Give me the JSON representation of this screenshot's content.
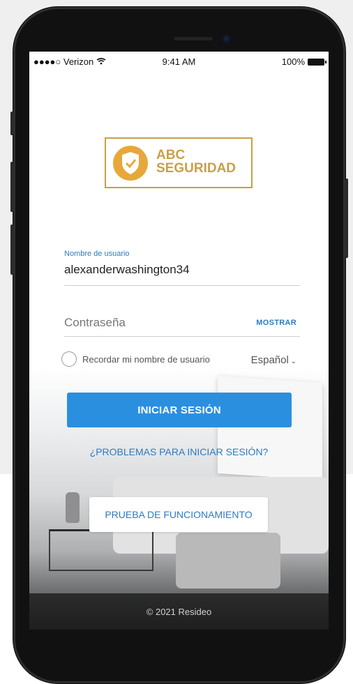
{
  "status_bar": {
    "carrier": "●●●●○ Verizon",
    "time": "9:41 AM",
    "battery": "100%"
  },
  "logo": {
    "line1": "ABC",
    "line2": "SEGURIDAD",
    "badge_color": "#e8a73a",
    "border_color": "#c9a046"
  },
  "username": {
    "label": "Nombre de usuario",
    "value": "alexanderwashington34"
  },
  "password": {
    "placeholder": "Contraseña",
    "show_label": "MOSTRAR"
  },
  "remember_label": "Recordar mi nombre de usuario",
  "language": "Español",
  "login_button": "INICIAR SESIÓN",
  "trouble_link": "¿PROBLEMAS PARA INICIAR SESIÓN?",
  "demo_button": "PRUEBA DE FUNCIONAMIENTO",
  "footer": "© 2021 Resideo",
  "colors": {
    "accent": "#2b8fe0",
    "link": "#2c7bc2"
  }
}
